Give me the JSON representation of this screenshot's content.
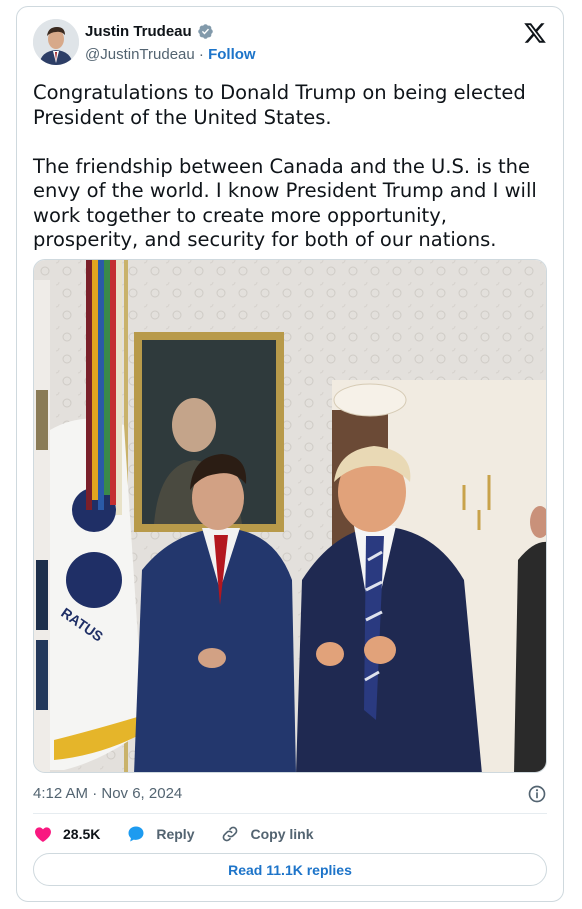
{
  "author": {
    "name": "Justin Trudeau",
    "handle": "@JustinTrudeau",
    "separator": "·",
    "follow_label": "Follow"
  },
  "tweet": {
    "text": "Congratulations to Donald Trump on being elected President of the United States.\n\nThe friendship between Canada and the U.S. is the envy of the world. I know President Trump and I will work together to create more opportunity, prosperity, and security for both of our nations."
  },
  "photo": {
    "flag_text": "RATUS"
  },
  "meta": {
    "timestamp": "4:12 AM · Nov 6, 2024"
  },
  "actions": {
    "likes": "28.5K",
    "reply_label": "Reply",
    "copy_link_label": "Copy link",
    "read_replies_label": "Read 11.1K replies"
  },
  "colors": {
    "accent": "#1d74c9",
    "like": "#f91880",
    "verified": "#829aab"
  }
}
